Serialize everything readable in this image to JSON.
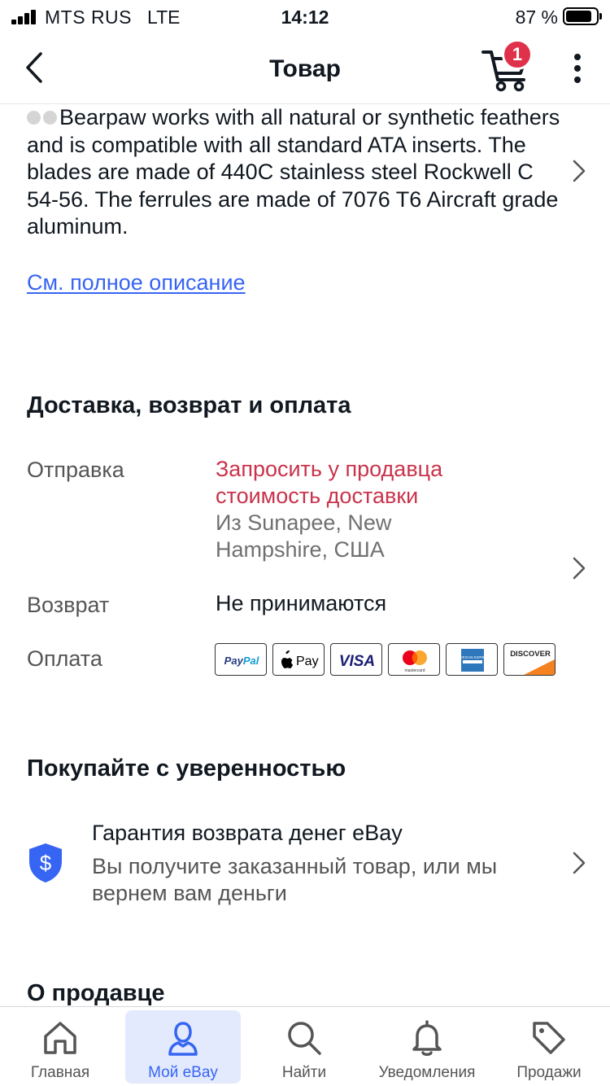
{
  "status_bar": {
    "carrier": "MTS RUS",
    "network": "LTE",
    "time": "14:12",
    "battery": "87 %",
    "battery_level": 0.87
  },
  "nav": {
    "title": "Товар",
    "back_icon": "chevron-left-icon",
    "cart_icon": "cart-icon",
    "cart_badge": "1",
    "more_icon": "more-vertical-icon"
  },
  "description": {
    "text": "Bearpaw works with all natural or synthetic feathers and is compatible with all standard ATA inserts. The blades are made of 440C stainless steel Rockwell C 54-56. The ferrules are made of 7076 T6 Aircraft grade aluminum.",
    "see_full_link": "См. полное описание"
  },
  "shipping_section": {
    "title": "Доставка, возврат и оплата",
    "shipping_label": "Отправка",
    "shipping_link": "Запросить у продавца стоимость доставки",
    "shipping_from": "Из Sunapee, New Hampshire, США",
    "returns_label": "Возврат",
    "returns_value": "Не принимаются",
    "payment_label": "Оплата",
    "payment_methods": [
      "PayPal",
      "Pay",
      "VISA",
      "mastercard",
      "AMERICAN EXPRESS",
      "DISCOVER"
    ]
  },
  "confidence_section": {
    "title": "Покупайте с уверенностью",
    "guarantee_title": "Гарантия возврата денег eBay",
    "guarantee_subtitle": "Вы получите заказанный товар, или мы вернем вам деньги",
    "guarantee_icon": "shield-dollar-icon"
  },
  "seller_section": {
    "title": "О продавце"
  },
  "tabbar": {
    "items": [
      {
        "label": "Главная",
        "icon": "home-icon"
      },
      {
        "label": "Мой eBay",
        "icon": "user-icon",
        "active": true
      },
      {
        "label": "Найти",
        "icon": "search-icon"
      },
      {
        "label": "Уведомления",
        "icon": "bell-icon"
      },
      {
        "label": "Продажи",
        "icon": "tag-icon"
      }
    ]
  },
  "colors": {
    "link": "#3665f3",
    "accent_red": "#c9334b",
    "badge": "#e0314b",
    "active_tab_bg": "#e3eafe",
    "shield": "#3665f3"
  }
}
